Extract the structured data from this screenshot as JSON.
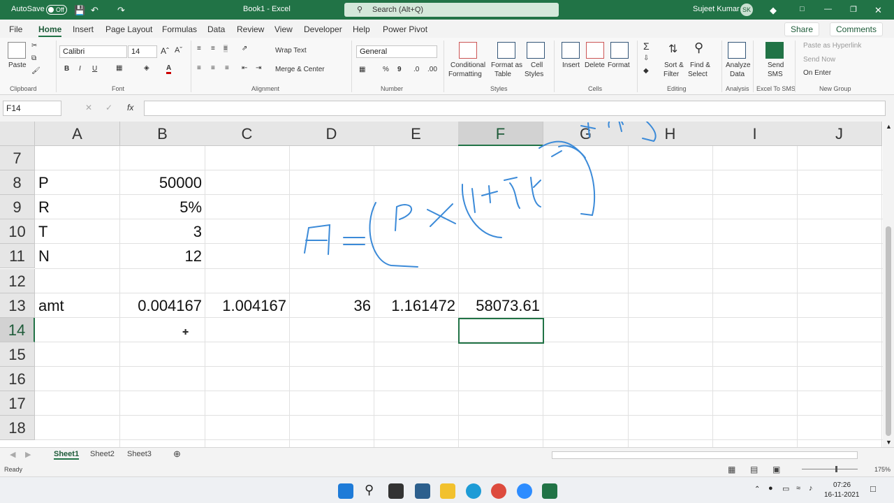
{
  "titlebar": {
    "autosave": "AutoSave",
    "autosave_state": "Off",
    "doc_title": "Book1 - Excel",
    "search_placeholder": "Search (Alt+Q)",
    "user": "Sujeet Kumar",
    "initials": "SK"
  },
  "tabs": [
    "File",
    "Home",
    "Insert",
    "Page Layout",
    "Formulas",
    "Data",
    "Review",
    "View",
    "Developer",
    "Help",
    "Power Pivot"
  ],
  "share": "Share",
  "comments": "Comments",
  "ribbon": {
    "clipboard": {
      "paste": "Paste",
      "label": "Clipboard"
    },
    "font": {
      "name": "Calibri",
      "size": "14",
      "label": "Font"
    },
    "alignment": {
      "wrap": "Wrap Text",
      "merge": "Merge & Center",
      "label": "Alignment"
    },
    "number": {
      "format": "General",
      "label": "Number"
    },
    "styles": {
      "conditional": "Conditional",
      "conditional2": "Formatting",
      "format_as": "Format as",
      "format_as2": "Table",
      "cell": "Cell",
      "cell2": "Styles",
      "label": "Styles"
    },
    "cells": {
      "insert": "Insert",
      "delete": "Delete",
      "format": "Format",
      "label": "Cells"
    },
    "editing": {
      "sort": "Sort &",
      "sort2": "Filter",
      "find": "Find &",
      "find2": "Select",
      "label": "Editing"
    },
    "analysis": {
      "analyze": "Analyze",
      "analyze2": "Data",
      "label": "Analysis"
    },
    "sms": {
      "send": "Send",
      "send2": "SMS",
      "label": "Excel To SMS"
    },
    "newgroup": {
      "paste_link": "Paste as Hyperlink",
      "send_now": "Send Now",
      "on_enter": "On Enter",
      "label": "New Group"
    }
  },
  "formula_bar": {
    "name_box": "F14",
    "fx": "fx",
    "content": ""
  },
  "grid": {
    "columns": [
      "A",
      "B",
      "C",
      "D",
      "E",
      "F",
      "G",
      "H",
      "I",
      "J"
    ],
    "rows": [
      "7",
      "8",
      "9",
      "10",
      "11",
      "12",
      "13",
      "14",
      "15",
      "16",
      "17",
      "18"
    ],
    "cells": {
      "A8": "P",
      "B8": "50000",
      "A9": "R",
      "B9": "5%",
      "A10": "T",
      "B10": "3",
      "A11": "N",
      "B11": "12",
      "A13": "amt",
      "B13": "0.004167",
      "C13": "1.004167",
      "D13": "36",
      "E13": "1.161472",
      "F13": "58073.61"
    },
    "selected": "F14"
  },
  "sheets": [
    "Sheet1",
    "Sheet2",
    "Sheet3"
  ],
  "status": {
    "ready": "Ready",
    "zoom": "175%"
  },
  "taskbar": {
    "time": "07:26",
    "date": "16-11-2021"
  }
}
